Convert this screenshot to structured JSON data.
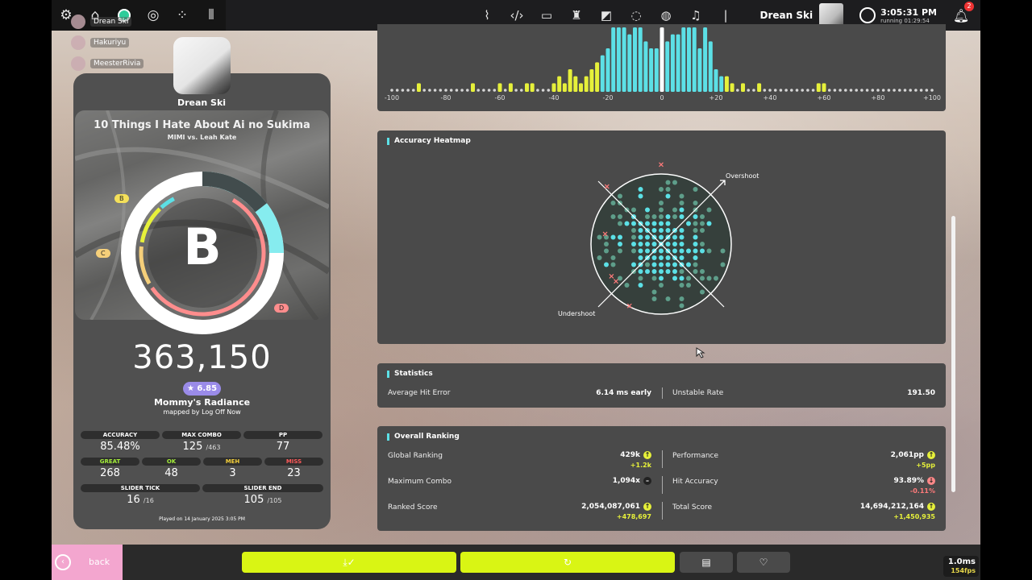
{
  "topbar": {
    "icons": [
      "gear-icon",
      "home-icon",
      "ruleset-osu-icon",
      "ruleset-taiko-icon",
      "ruleset-catch-icon",
      "ruleset-mania-icon"
    ],
    "right_icons": [
      "news-icon",
      "code-icon",
      "wiki-icon",
      "rankings-icon",
      "beatmap-listing-icon",
      "chat-icon",
      "web-globe-icon",
      "music-icon"
    ],
    "username": "Drean Ski",
    "clock_time": "3:05:31 PM",
    "clock_running": "running 01:29:54",
    "notification_count": "2"
  },
  "spectators": [
    "Drean Ski",
    "Hakuriyu",
    "MeesterRivia"
  ],
  "result": {
    "player": "Drean Ski",
    "song_title": "10 Things I Hate About Ai no Sukima",
    "song_artist": "MIMI vs. Leah Kate",
    "grade": "B",
    "rank_pills": {
      "b": "B",
      "c": "C",
      "d": "D"
    },
    "score": "363,150",
    "star_rating": "★ 6.85",
    "difficulty": "Mommy's Radiance",
    "mapper": "mapped by Log Off Now",
    "accuracy_fraction": 0.8548,
    "stats_top": [
      {
        "label": "ACCURACY",
        "value": "85.48%",
        "sub": ""
      },
      {
        "label": "MAX COMBO",
        "value": "125",
        "sub": "/463"
      },
      {
        "label": "PP",
        "value": "77",
        "sub": ""
      }
    ],
    "stats_hits": [
      {
        "label": "GREAT",
        "value": "268",
        "color": "#a4ee3a"
      },
      {
        "label": "OK",
        "value": "48",
        "color": "#a4ee3a"
      },
      {
        "label": "MEH",
        "value": "3",
        "color": "#f4cf3a"
      },
      {
        "label": "MISS",
        "value": "23",
        "color": "#ff5a5a"
      }
    ],
    "stats_slider": [
      {
        "label": "SLIDER TICK",
        "value": "16",
        "sub": "/16"
      },
      {
        "label": "SLIDER END",
        "value": "105",
        "sub": "/105"
      }
    ],
    "played_on": "Played on 14 January 2025 3:05 PM"
  },
  "chart_data": [
    {
      "type": "bar",
      "title": "",
      "xlabel": "",
      "ylabel": "",
      "x_ticks": [
        "-100",
        "-80",
        "-60",
        "-40",
        "-20",
        "0",
        "+20",
        "+40",
        "+60",
        "+80",
        "+100"
      ],
      "xlim": [
        -100,
        100
      ],
      "x": [
        -100,
        -98,
        -96,
        -94,
        -92,
        -90,
        -88,
        -86,
        -84,
        -82,
        -80,
        -78,
        -76,
        -74,
        -72,
        -70,
        -68,
        -66,
        -64,
        -62,
        -60,
        -58,
        -56,
        -54,
        -52,
        -50,
        -48,
        -46,
        -44,
        -42,
        -40,
        -38,
        -36,
        -34,
        -32,
        -30,
        -28,
        -26,
        -24,
        -22,
        -20,
        -18,
        -16,
        -14,
        -12,
        -10,
        -8,
        -6,
        -4,
        -2,
        0,
        2,
        4,
        6,
        8,
        10,
        12,
        14,
        16,
        18,
        20,
        22,
        24,
        26,
        28,
        30,
        32,
        34,
        36,
        38,
        40,
        42,
        44,
        46,
        48,
        50,
        52,
        54,
        56,
        58,
        60,
        62,
        64,
        66,
        68,
        70,
        72,
        74,
        76,
        78,
        80,
        82,
        84,
        86,
        88,
        90,
        92,
        94,
        96,
        98,
        100
      ],
      "values": [
        0,
        0,
        0,
        0,
        0,
        1,
        0,
        0,
        0,
        0,
        0,
        0,
        0,
        0,
        0,
        1,
        0,
        0,
        0,
        0,
        1,
        0,
        1,
        0,
        0,
        1,
        1,
        0,
        0,
        0,
        1,
        2,
        1,
        3,
        2,
        1,
        2,
        3,
        4,
        5,
        6,
        9,
        10,
        11,
        8,
        9,
        9,
        7,
        6,
        6,
        10,
        7,
        8,
        8,
        9,
        9,
        9,
        6,
        9,
        7,
        3,
        2,
        2,
        1,
        0,
        1,
        0,
        0,
        1,
        0,
        0,
        0,
        0,
        0,
        0,
        0,
        0,
        0,
        0,
        1,
        1,
        0,
        0,
        0,
        0,
        0,
        0,
        0,
        0,
        0,
        0,
        0,
        0,
        0,
        0,
        0,
        0,
        0,
        0,
        0,
        0
      ],
      "colors": {
        "in_window": "#5ce0e6",
        "outside": "#e6f03a",
        "zero_line": "#ffffff"
      }
    },
    {
      "type": "scatter",
      "title": "Accuracy Heatmap",
      "labels": {
        "overshoot": "Overshoot",
        "undershoot": "Undershoot"
      },
      "hit_color_dim": "#5e9e8a",
      "hit_color_bright": "#5ce0e6",
      "miss_color": "#ff7a7a",
      "misses": [
        [
          -62,
          -12
        ],
        [
          -55,
          38
        ],
        [
          -50,
          44
        ],
        [
          -35,
          73
        ],
        [
          0,
          -94
        ],
        [
          -60,
          -68
        ]
      ]
    }
  ],
  "statistics": {
    "title": "Statistics",
    "avg_hit_error_label": "Average Hit Error",
    "avg_hit_error_value": "6.14 ms early",
    "unstable_rate_label": "Unstable Rate",
    "unstable_rate_value": "191.50"
  },
  "ranking": {
    "title": "Overall Ranking",
    "left": [
      {
        "label": "Global Ranking",
        "value": "429k",
        "delta": "+1.2k",
        "trend": "up"
      },
      {
        "label": "Maximum Combo",
        "value": "1,094x",
        "delta": "",
        "trend": "same"
      },
      {
        "label": "Ranked Score",
        "value": "2,054,087,061",
        "delta": "+478,697",
        "trend": "up"
      }
    ],
    "right": [
      {
        "label": "Performance",
        "value": "2,061pp",
        "delta": "+5pp",
        "trend": "up"
      },
      {
        "label": "Hit Accuracy",
        "value": "93.89%",
        "delta": "-0.11%",
        "trend": "down"
      },
      {
        "label": "Total Score",
        "value": "14,694,212,164",
        "delta": "+1,450,935",
        "trend": "up"
      }
    ]
  },
  "bottom": {
    "back_label": "back",
    "buttons": [
      "download-icon",
      "retry-icon",
      "beatmap-info-icon",
      "favourite-icon"
    ],
    "frame_ms": "1.0ms",
    "fps": "154fps"
  }
}
